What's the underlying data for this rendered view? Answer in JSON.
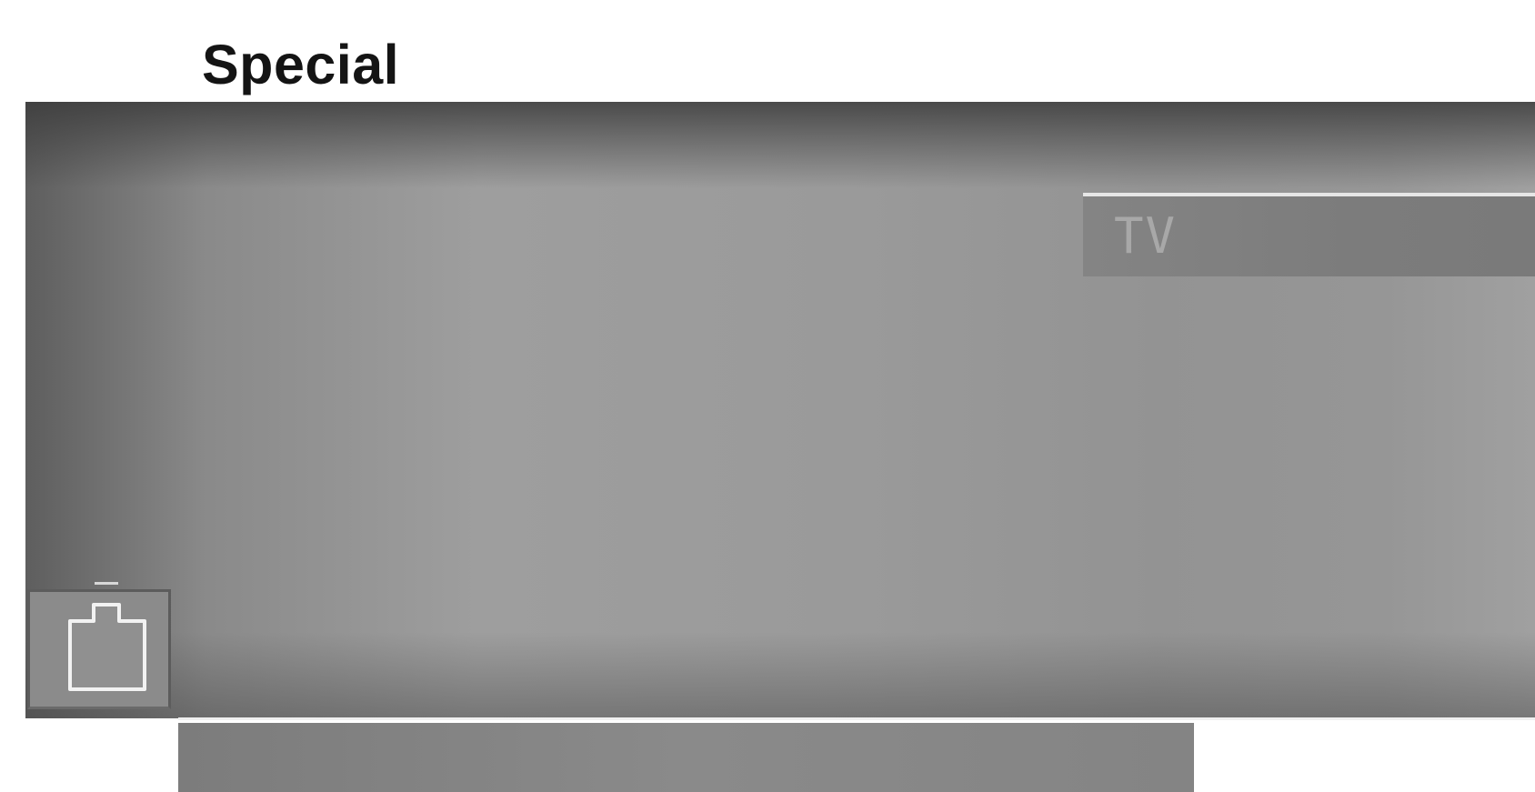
{
  "page": {
    "heading": "Special"
  },
  "osd_menu": {
    "selected_item_label": "TV",
    "left_icon": "outlet-icon"
  },
  "colors": {
    "screen_background": "#9a9a9a",
    "menu_item_background": "#808080",
    "menu_item_text": "#a8a8a8",
    "heading_text": "#141414"
  }
}
